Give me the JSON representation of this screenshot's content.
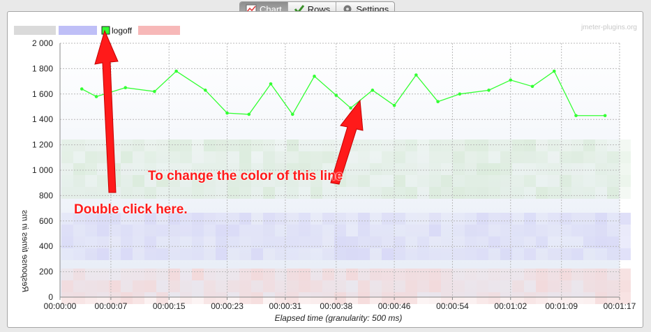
{
  "tabs": [
    {
      "label": "Chart",
      "icon": "chart-icon",
      "active": true
    },
    {
      "label": "Rows",
      "icon": "checkmark-icon",
      "active": false
    },
    {
      "label": "Settings",
      "icon": "gear-icon",
      "active": false
    }
  ],
  "watermark": "jmeter-plugins.org",
  "annotations": {
    "line_note": "To change the color of this line",
    "legend_note": "Double click here."
  },
  "colors": {
    "series_line": "#33ff33",
    "arrow": "#ff1a1a",
    "annotation_text": "#ff1a1a"
  },
  "chart_data": {
    "type": "line",
    "xlabel": "Elapsed time (granularity: 500 ms)",
    "ylabel": "Response times in ms",
    "ylim": [
      0,
      2000
    ],
    "y_ticks": [
      "0",
      "200",
      "400",
      "600",
      "800",
      "1 000",
      "1 200",
      "1 400",
      "1 600",
      "1 800",
      "2 000"
    ],
    "x_ticks": [
      "00:00:00",
      "00:00:07",
      "00:00:15",
      "00:00:23",
      "00:00:31",
      "00:00:38",
      "00:00:46",
      "00:00:54",
      "00:01:02",
      "00:01:09",
      "00:01:17"
    ],
    "grid": true,
    "legend_position": "top-left",
    "series": [
      {
        "name": "logoff",
        "color": "#33ff33",
        "x": [
          "00:00:03",
          "00:00:05",
          "00:00:09",
          "00:00:13",
          "00:00:16",
          "00:00:20",
          "00:00:23",
          "00:00:26",
          "00:00:29",
          "00:00:32",
          "00:00:35",
          "00:00:38",
          "00:00:40",
          "00:00:43",
          "00:00:46",
          "00:00:49",
          "00:00:52",
          "00:00:55",
          "00:00:59",
          "00:01:02",
          "00:01:05",
          "00:01:08",
          "00:01:11",
          "00:01:15"
        ],
        "values": [
          1640,
          1580,
          1650,
          1620,
          1780,
          1630,
          1450,
          1440,
          1680,
          1440,
          1740,
          1590,
          1490,
          1630,
          1510,
          1750,
          1540,
          1600,
          1630,
          1710,
          1660,
          1780,
          1430,
          1430
        ]
      }
    ]
  }
}
